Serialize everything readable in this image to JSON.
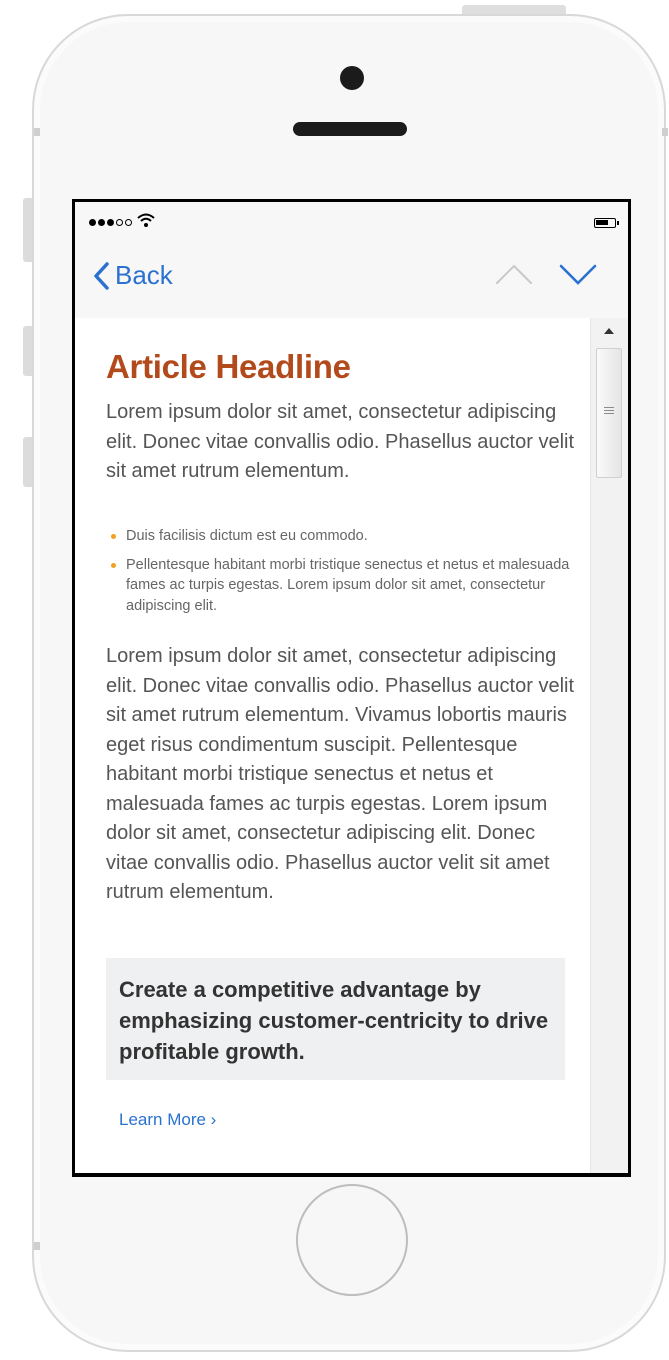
{
  "nav": {
    "back_label": "Back"
  },
  "article": {
    "headline": "Article Headline",
    "intro": "Lorem ipsum dolor sit amet, consectetur adipiscing elit. Donec vitae convallis odio. Phasellus auctor velit sit amet rutrum elementum.",
    "bullets": [
      "Duis facilisis dictum est eu commodo.",
      "Pellentesque habitant morbi tristique senectus et netus et malesuada fames ac turpis egestas. Lorem ipsum dolor sit amet, consectetur adipiscing elit."
    ],
    "body": "Lorem ipsum dolor sit amet, consectetur adipiscing elit. Donec vitae convallis odio. Phasellus auctor velit sit amet rutrum elementum. Vivamus lobortis mauris eget risus condimentum suscipit. Pellentesque habitant morbi tristique senectus et netus et malesuada fames ac turpis egestas. Lorem ipsum dolor sit amet, consectetur adipiscing elit. Donec vitae convallis odio. Phasellus auctor velit sit amet rutrum elementum.",
    "callout": "Create a competitive advantage by emphasizing customer-centricity to drive profitable growth.",
    "learn_more": "Learn More ›"
  },
  "colors": {
    "accent": "#2a71d0",
    "headline": "#b34a1b",
    "bullet": "#f0a21e"
  },
  "icons": {
    "back": "chevron-left-icon",
    "prev": "chevron-up-icon",
    "next": "chevron-down-icon",
    "wifi": "wifi-icon",
    "battery": "battery-icon",
    "scroll_up": "scroll-up-arrow-icon"
  }
}
